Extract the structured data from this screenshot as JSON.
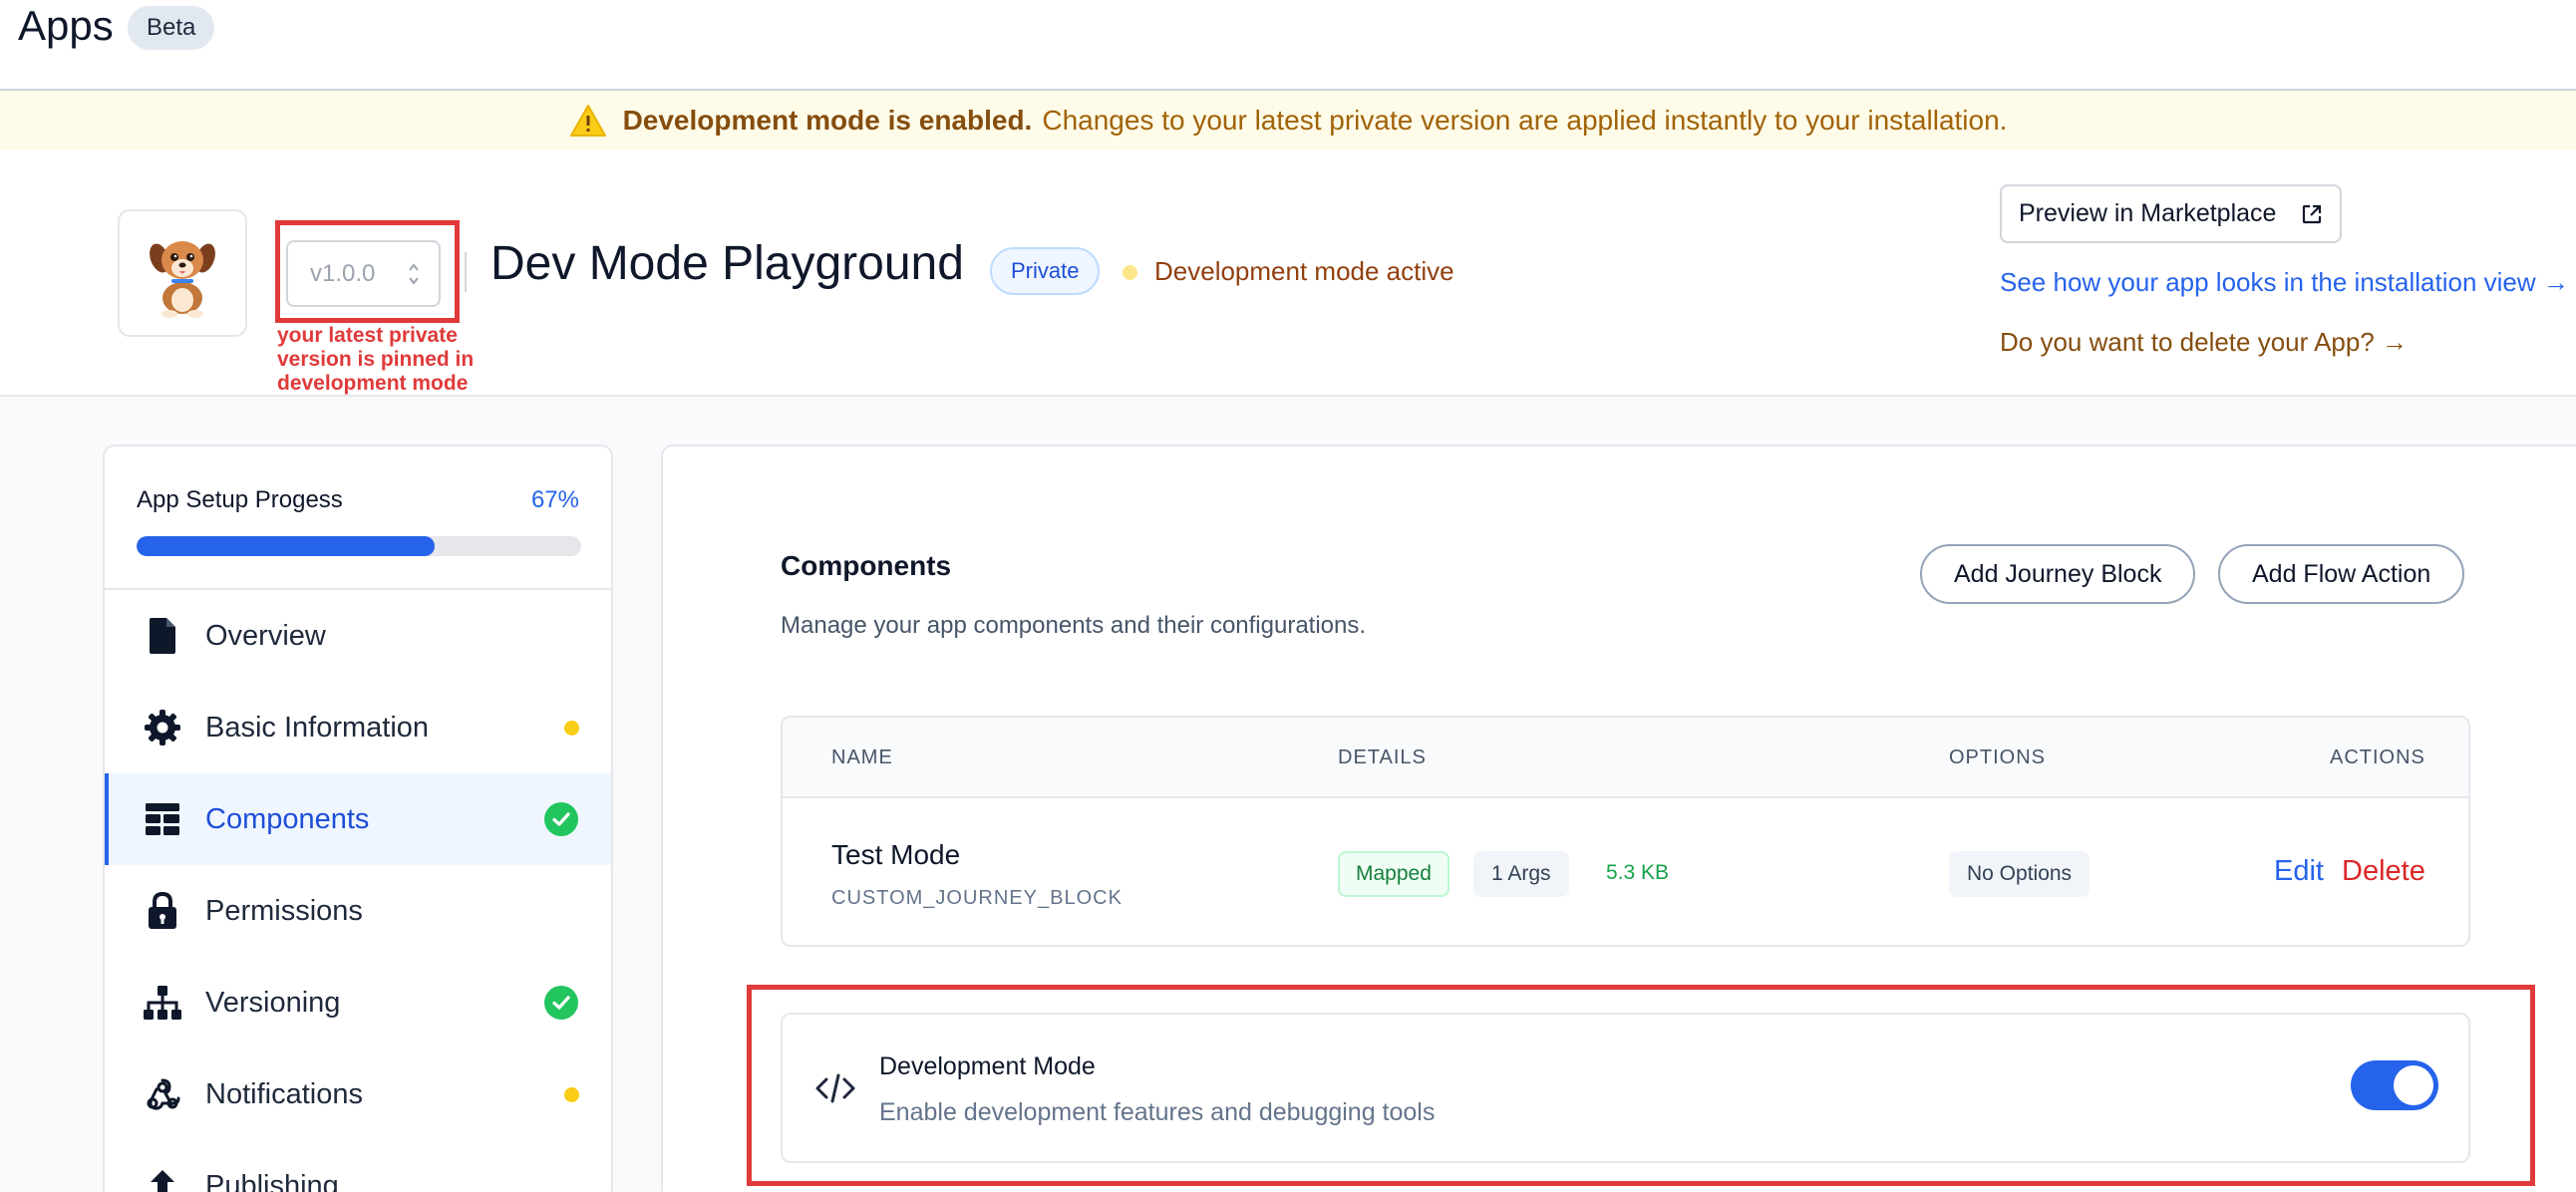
{
  "topbar": {
    "title": "Apps",
    "badge": "Beta"
  },
  "banner": {
    "strong": "Development mode is enabled.",
    "message": "Changes to your latest private version are applied instantly to your installation."
  },
  "app": {
    "version": "v1.0.0",
    "annotation_note": "your latest private version is pinned in development mode",
    "name": "Dev Mode Playground",
    "visibility_badge": "Private",
    "status": "Development mode active",
    "preview_button": "Preview in Marketplace",
    "install_view_link": "See how your app looks in the installation view →",
    "delete_link": "Do you want to delete your App? →"
  },
  "sidebar": {
    "progress_label": "App Setup Progess",
    "progress_value": "67%",
    "progress_fraction": 0.67,
    "items": [
      {
        "label": "Overview",
        "icon": "document-icon",
        "status": "none"
      },
      {
        "label": "Basic Information",
        "icon": "gear-icon",
        "status": "pending"
      },
      {
        "label": "Components",
        "icon": "components-icon",
        "status": "complete",
        "active": true
      },
      {
        "label": "Permissions",
        "icon": "lock-icon",
        "status": "none"
      },
      {
        "label": "Versioning",
        "icon": "hierarchy-icon",
        "status": "complete"
      },
      {
        "label": "Notifications",
        "icon": "webhook-icon",
        "status": "pending"
      },
      {
        "label": "Publishing",
        "icon": "upload-icon",
        "status": "none"
      }
    ]
  },
  "main": {
    "title": "Components",
    "description": "Manage your app components and their configurations.",
    "add_journey_button": "Add Journey Block",
    "add_flow_button": "Add Flow Action",
    "table": {
      "headers": {
        "name": "NAME",
        "details": "DETAILS",
        "options": "OPTIONS",
        "actions": "ACTIONS"
      },
      "rows": [
        {
          "name": "Test Mode",
          "type": "CUSTOM_JOURNEY_BLOCK",
          "mapped": "Mapped",
          "args": "1 Args",
          "size": "5.3 KB",
          "options": "No Options",
          "edit": "Edit",
          "delete": "Delete"
        }
      ]
    },
    "dev_mode": {
      "title": "Development Mode",
      "description": "Enable development features and debugging tools",
      "enabled": true
    }
  },
  "colors": {
    "accent": "#2563eb",
    "annotation": "#e03a3a",
    "warning": "#facc15",
    "success": "#22c55e",
    "danger": "#dc2626"
  }
}
